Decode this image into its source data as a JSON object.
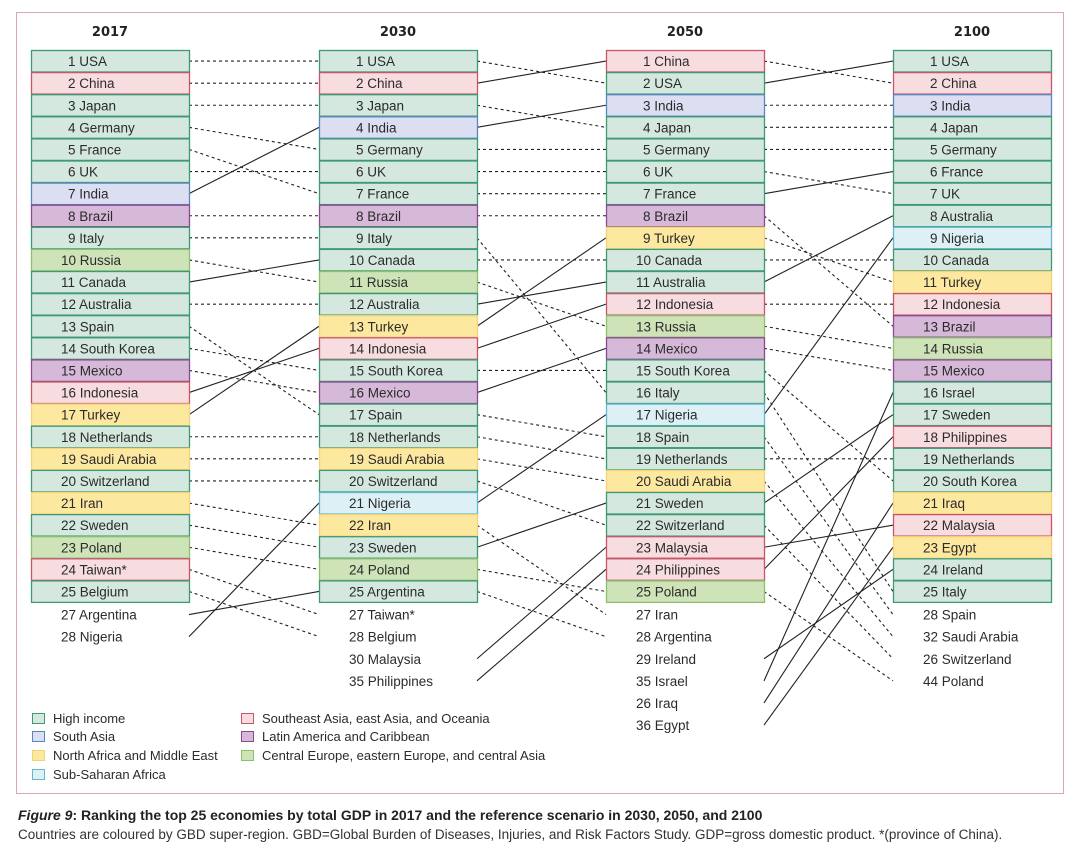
{
  "chart_data": {
    "type": "bump",
    "title": "Ranking the top 25 economies by total GDP in 2017 and the reference scenario in 2030, 2050, and 2100",
    "columns": [
      {
        "year": "2017",
        "ranked": [
          {
            "rank": 1,
            "country": "USA",
            "region": "high"
          },
          {
            "rank": 2,
            "country": "China",
            "region": "seasia"
          },
          {
            "rank": 3,
            "country": "Japan",
            "region": "high"
          },
          {
            "rank": 4,
            "country": "Germany",
            "region": "high"
          },
          {
            "rank": 5,
            "country": "France",
            "region": "high"
          },
          {
            "rank": 6,
            "country": "UK",
            "region": "high"
          },
          {
            "rank": 7,
            "country": "India",
            "region": "sasia"
          },
          {
            "rank": 8,
            "country": "Brazil",
            "region": "latam"
          },
          {
            "rank": 9,
            "country": "Italy",
            "region": "high"
          },
          {
            "rank": 10,
            "country": "Russia",
            "region": "ceeca"
          },
          {
            "rank": 11,
            "country": "Canada",
            "region": "high"
          },
          {
            "rank": 12,
            "country": "Australia",
            "region": "high"
          },
          {
            "rank": 13,
            "country": "Spain",
            "region": "high"
          },
          {
            "rank": 14,
            "country": "South Korea",
            "region": "high"
          },
          {
            "rank": 15,
            "country": "Mexico",
            "region": "latam"
          },
          {
            "rank": 16,
            "country": "Indonesia",
            "region": "seasia"
          },
          {
            "rank": 17,
            "country": "Turkey",
            "region": "mena"
          },
          {
            "rank": 18,
            "country": "Netherlands",
            "region": "high"
          },
          {
            "rank": 19,
            "country": "Saudi Arabia",
            "region": "mena"
          },
          {
            "rank": 20,
            "country": "Switzerland",
            "region": "high"
          },
          {
            "rank": 21,
            "country": "Iran",
            "region": "mena"
          },
          {
            "rank": 22,
            "country": "Sweden",
            "region": "high"
          },
          {
            "rank": 23,
            "country": "Poland",
            "region": "ceeca"
          },
          {
            "rank": 24,
            "country": "Taiwan*",
            "region": "seasia"
          },
          {
            "rank": 25,
            "country": "Belgium",
            "region": "high"
          }
        ],
        "extra": [
          {
            "rank": 27,
            "country": "Argentina"
          },
          {
            "rank": 28,
            "country": "Nigeria"
          }
        ]
      },
      {
        "year": "2030",
        "ranked": [
          {
            "rank": 1,
            "country": "USA",
            "region": "high"
          },
          {
            "rank": 2,
            "country": "China",
            "region": "seasia"
          },
          {
            "rank": 3,
            "country": "Japan",
            "region": "high"
          },
          {
            "rank": 4,
            "country": "India",
            "region": "sasia"
          },
          {
            "rank": 5,
            "country": "Germany",
            "region": "high"
          },
          {
            "rank": 6,
            "country": "UK",
            "region": "high"
          },
          {
            "rank": 7,
            "country": "France",
            "region": "high"
          },
          {
            "rank": 8,
            "country": "Brazil",
            "region": "latam"
          },
          {
            "rank": 9,
            "country": "Italy",
            "region": "high"
          },
          {
            "rank": 10,
            "country": "Canada",
            "region": "high"
          },
          {
            "rank": 11,
            "country": "Russia",
            "region": "ceeca"
          },
          {
            "rank": 12,
            "country": "Australia",
            "region": "high"
          },
          {
            "rank": 13,
            "country": "Turkey",
            "region": "mena"
          },
          {
            "rank": 14,
            "country": "Indonesia",
            "region": "seasia"
          },
          {
            "rank": 15,
            "country": "South Korea",
            "region": "high"
          },
          {
            "rank": 16,
            "country": "Mexico",
            "region": "latam"
          },
          {
            "rank": 17,
            "country": "Spain",
            "region": "high"
          },
          {
            "rank": 18,
            "country": "Netherlands",
            "region": "high"
          },
          {
            "rank": 19,
            "country": "Saudi Arabia",
            "region": "mena"
          },
          {
            "rank": 20,
            "country": "Switzerland",
            "region": "high"
          },
          {
            "rank": 21,
            "country": "Nigeria",
            "region": "ssa"
          },
          {
            "rank": 22,
            "country": "Iran",
            "region": "mena"
          },
          {
            "rank": 23,
            "country": "Sweden",
            "region": "high"
          },
          {
            "rank": 24,
            "country": "Poland",
            "region": "ceeca"
          },
          {
            "rank": 25,
            "country": "Argentina",
            "region": "high"
          }
        ],
        "extra": [
          {
            "rank": 27,
            "country": "Taiwan*"
          },
          {
            "rank": 28,
            "country": "Belgium"
          },
          {
            "rank": 30,
            "country": "Malaysia"
          },
          {
            "rank": 35,
            "country": "Philippines"
          }
        ]
      },
      {
        "year": "2050",
        "ranked": [
          {
            "rank": 1,
            "country": "China",
            "region": "seasia"
          },
          {
            "rank": 2,
            "country": "USA",
            "region": "high"
          },
          {
            "rank": 3,
            "country": "India",
            "region": "sasia"
          },
          {
            "rank": 4,
            "country": "Japan",
            "region": "high"
          },
          {
            "rank": 5,
            "country": "Germany",
            "region": "high"
          },
          {
            "rank": 6,
            "country": "UK",
            "region": "high"
          },
          {
            "rank": 7,
            "country": "France",
            "region": "high"
          },
          {
            "rank": 8,
            "country": "Brazil",
            "region": "latam"
          },
          {
            "rank": 9,
            "country": "Turkey",
            "region": "mena"
          },
          {
            "rank": 10,
            "country": "Canada",
            "region": "high"
          },
          {
            "rank": 11,
            "country": "Australia",
            "region": "high"
          },
          {
            "rank": 12,
            "country": "Indonesia",
            "region": "seasia"
          },
          {
            "rank": 13,
            "country": "Russia",
            "region": "ceeca"
          },
          {
            "rank": 14,
            "country": "Mexico",
            "region": "latam"
          },
          {
            "rank": 15,
            "country": "South Korea",
            "region": "high"
          },
          {
            "rank": 16,
            "country": "Italy",
            "region": "high"
          },
          {
            "rank": 17,
            "country": "Nigeria",
            "region": "ssa"
          },
          {
            "rank": 18,
            "country": "Spain",
            "region": "high"
          },
          {
            "rank": 19,
            "country": "Netherlands",
            "region": "high"
          },
          {
            "rank": 20,
            "country": "Saudi Arabia",
            "region": "mena"
          },
          {
            "rank": 21,
            "country": "Sweden",
            "region": "high"
          },
          {
            "rank": 22,
            "country": "Switzerland",
            "region": "high"
          },
          {
            "rank": 23,
            "country": "Malaysia",
            "region": "seasia"
          },
          {
            "rank": 24,
            "country": "Philippines",
            "region": "seasia"
          },
          {
            "rank": 25,
            "country": "Poland",
            "region": "ceeca"
          }
        ],
        "extra": [
          {
            "rank": 27,
            "country": "Iran"
          },
          {
            "rank": 28,
            "country": "Argentina"
          },
          {
            "rank": 29,
            "country": "Ireland"
          },
          {
            "rank": 35,
            "country": "Israel"
          },
          {
            "rank": 26,
            "country": "Iraq"
          },
          {
            "rank": 36,
            "country": "Egypt"
          }
        ]
      },
      {
        "year": "2100",
        "ranked": [
          {
            "rank": 1,
            "country": "USA",
            "region": "high"
          },
          {
            "rank": 2,
            "country": "China",
            "region": "seasia"
          },
          {
            "rank": 3,
            "country": "India",
            "region": "sasia"
          },
          {
            "rank": 4,
            "country": "Japan",
            "region": "high"
          },
          {
            "rank": 5,
            "country": "Germany",
            "region": "high"
          },
          {
            "rank": 6,
            "country": "France",
            "region": "high"
          },
          {
            "rank": 7,
            "country": "UK",
            "region": "high"
          },
          {
            "rank": 8,
            "country": "Australia",
            "region": "high"
          },
          {
            "rank": 9,
            "country": "Nigeria",
            "region": "ssa"
          },
          {
            "rank": 10,
            "country": "Canada",
            "region": "high"
          },
          {
            "rank": 11,
            "country": "Turkey",
            "region": "mena"
          },
          {
            "rank": 12,
            "country": "Indonesia",
            "region": "seasia"
          },
          {
            "rank": 13,
            "country": "Brazil",
            "region": "latam"
          },
          {
            "rank": 14,
            "country": "Russia",
            "region": "ceeca"
          },
          {
            "rank": 15,
            "country": "Mexico",
            "region": "latam"
          },
          {
            "rank": 16,
            "country": "Israel",
            "region": "high"
          },
          {
            "rank": 17,
            "country": "Sweden",
            "region": "high"
          },
          {
            "rank": 18,
            "country": "Philippines",
            "region": "seasia"
          },
          {
            "rank": 19,
            "country": "Netherlands",
            "region": "high"
          },
          {
            "rank": 20,
            "country": "South Korea",
            "region": "high"
          },
          {
            "rank": 21,
            "country": "Iraq",
            "region": "mena"
          },
          {
            "rank": 22,
            "country": "Malaysia",
            "region": "seasia"
          },
          {
            "rank": 23,
            "country": "Egypt",
            "region": "mena"
          },
          {
            "rank": 24,
            "country": "Ireland",
            "region": "high"
          },
          {
            "rank": 25,
            "country": "Italy",
            "region": "high"
          }
        ],
        "extra": [
          {
            "rank": 28,
            "country": "Spain"
          },
          {
            "rank": 32,
            "country": "Saudi Arabia"
          },
          {
            "rank": 26,
            "country": "Switzerland"
          },
          {
            "rank": 44,
            "country": "Poland"
          }
        ]
      }
    ],
    "line_style_rule": "solid = rank improves, dashed = rank unchanged or declines"
  },
  "regions": {
    "high": {
      "label": "High income",
      "fill": "#d5e8df",
      "border": "#3e9a73"
    },
    "sasia": {
      "label": "South Asia",
      "fill": "#dcdff2",
      "border": "#5a86c0"
    },
    "mena": {
      "label": "North Africa and Middle East",
      "fill": "#fde8a0",
      "border": "#f3d37a"
    },
    "ssa": {
      "label": "Sub-Saharan Africa",
      "fill": "#dcf0f5",
      "border": "#63b8cf"
    },
    "seasia": {
      "label": "Southeast Asia, east Asia, and Oceania",
      "fill": "#f8dde0",
      "border": "#c7566b"
    },
    "latam": {
      "label": "Latin America and Caribbean",
      "fill": "#d6b9d8",
      "border": "#8a4a8f"
    },
    "ceeca": {
      "label": "Central Europe, eastern Europe, and central Asia",
      "fill": "#cfe3b9",
      "border": "#8cbf6e"
    }
  },
  "legend": {
    "left": [
      "high",
      "sasia",
      "mena",
      "ssa"
    ],
    "right": [
      "seasia",
      "latam",
      "ceeca"
    ]
  },
  "caption": {
    "figure_label": "Figure 9",
    "title": ": Ranking the top 25 economies by total GDP in 2017 and the reference scenario in 2030, 2050, and 2100",
    "text": "Countries are coloured by GBD super-region. GBD=Global Burden of Diseases, Injuries, and Risk Factors Study. GDP=gross domestic product. *(province of China)."
  }
}
